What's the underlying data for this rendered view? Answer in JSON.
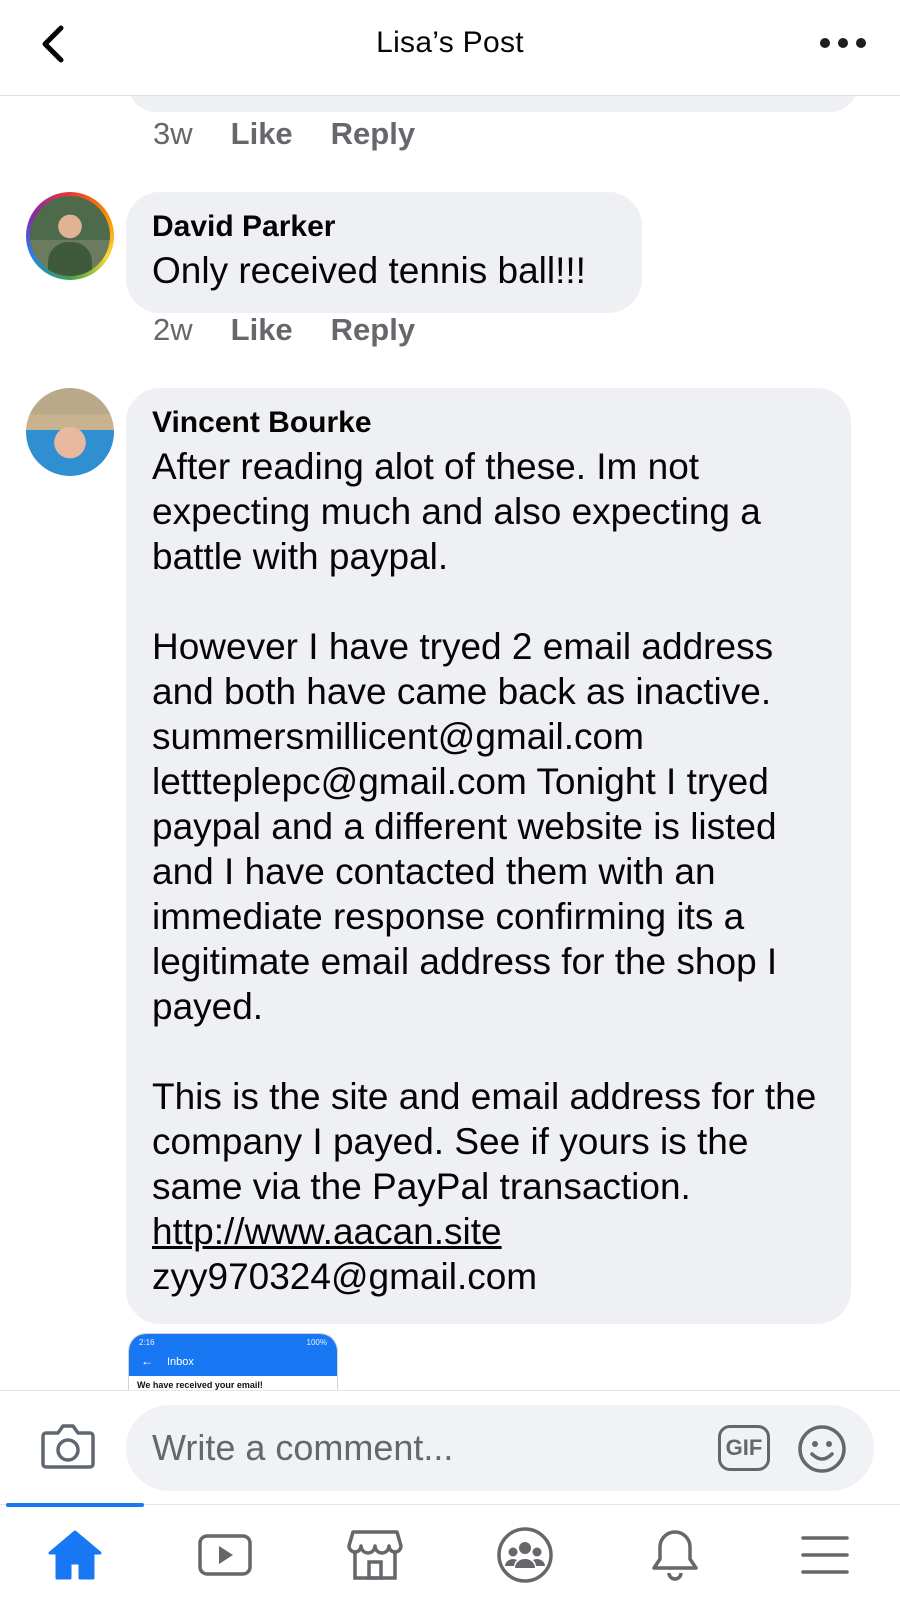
{
  "header": {
    "title": "Lisa’s Post",
    "back_icon": "chevron-left-icon",
    "more_icon": "more-horizontal-icon"
  },
  "comments": [
    {
      "time": "3w",
      "like_label": "Like",
      "reply_label": "Reply"
    },
    {
      "author": "David Parker",
      "text": "Only received tennis ball!!!",
      "time": "2w",
      "like_label": "Like",
      "reply_label": "Reply"
    },
    {
      "author": "Vincent Bourke",
      "paragraphs": [
        "After reading alot of these. Im not expecting much and also expecting a battle with paypal.",
        "However I have tryed 2 email address and both have came back as inactive. summersmillicent@gmail.com lettteplepc@gmail.com Tonight I tryed paypal and a different website is listed and I have contacted them with an immediate response confirming its a legitimate email address for the shop I payed.",
        "This is the site and email address for the company I payed. See if yours is the same via the PayPal transaction."
      ],
      "link": "http://www.aacan.site",
      "email": "zyy970324@gmail.com",
      "attachment": {
        "status_bar": "2:16",
        "status_right": "100%",
        "app_title": "Inbox",
        "preview_text": "We have received your email!"
      }
    }
  ],
  "composer": {
    "placeholder": "Write a comment...",
    "gif_label": "GIF",
    "camera_icon": "camera-icon",
    "emoji_icon": "emoji-icon"
  },
  "nav": {
    "tabs": [
      "home-icon",
      "video-icon",
      "marketplace-icon",
      "groups-icon",
      "notifications-icon",
      "menu-icon"
    ],
    "active_color": "#1877f2",
    "inactive_color": "#65676b"
  }
}
